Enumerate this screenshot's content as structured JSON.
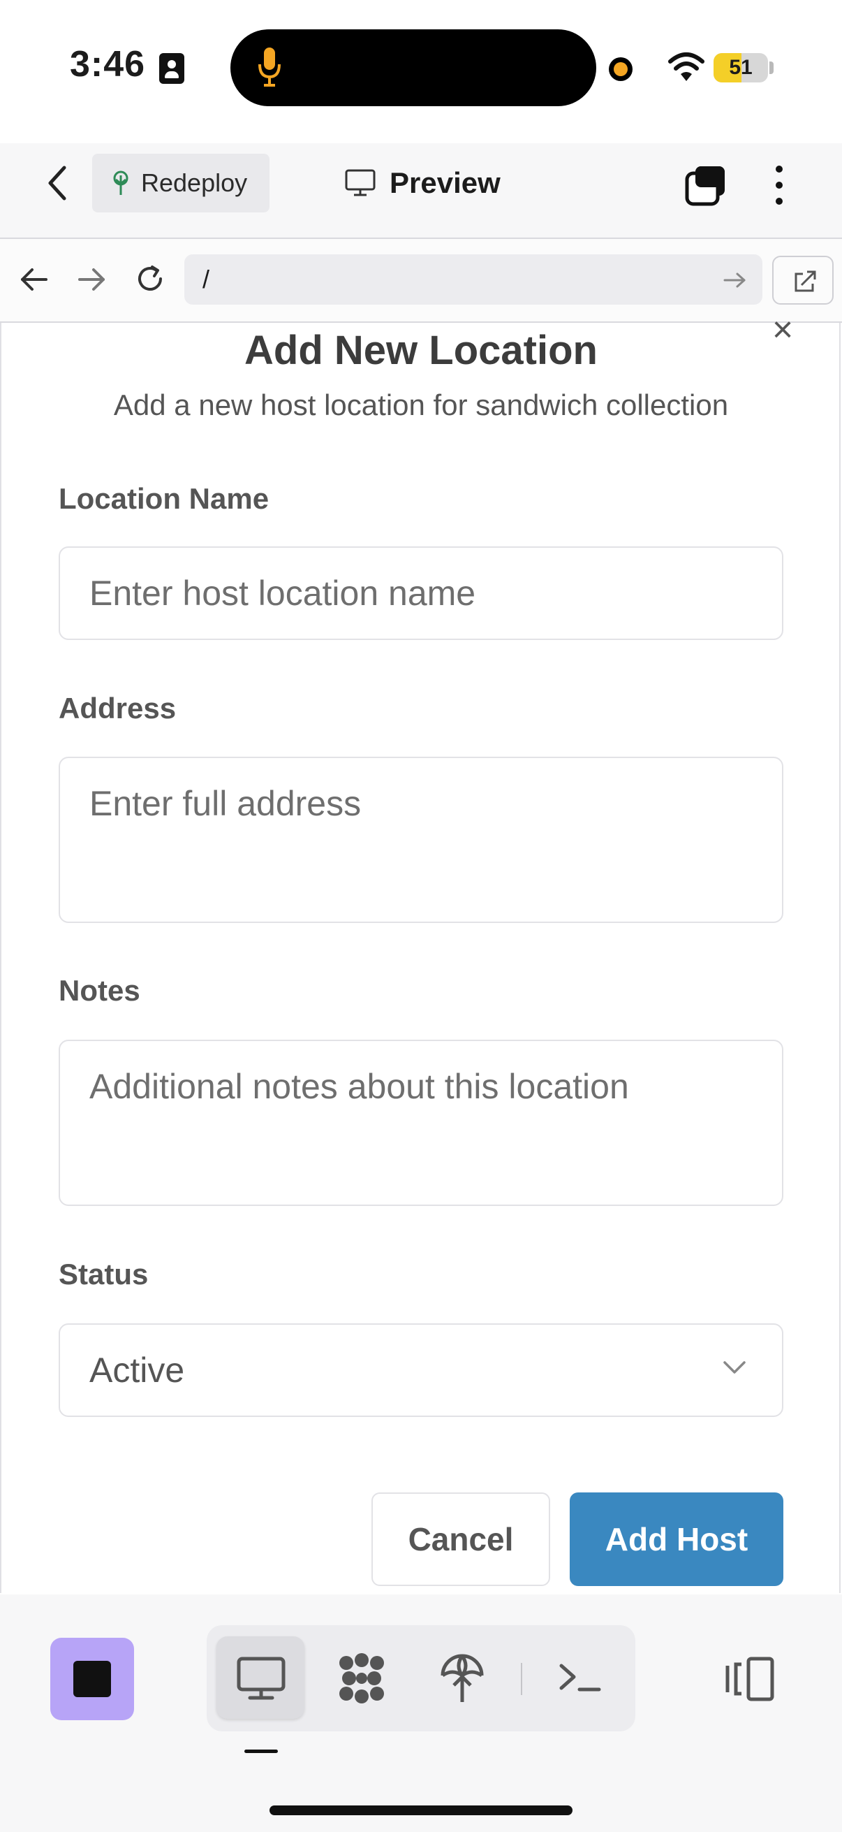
{
  "status_bar": {
    "time": "3:46",
    "battery_level": "51"
  },
  "app_bar": {
    "redeploy_label": "Redeploy",
    "preview_label": "Preview"
  },
  "url_bar": {
    "path": "/"
  },
  "dialog": {
    "title": "Add New Location",
    "subtitle": "Add a new host location for sandwich collection",
    "close_glyph": "×",
    "fields": {
      "name": {
        "label": "Location Name",
        "placeholder": "Enter host location name"
      },
      "address": {
        "label": "Address",
        "placeholder": "Enter full address"
      },
      "notes": {
        "label": "Notes",
        "placeholder": "Additional notes about this location"
      },
      "status": {
        "label": "Status",
        "value": "Active"
      }
    },
    "cancel_label": "Cancel",
    "submit_label": "Add Host",
    "colors": {
      "primary": "#3a88c0"
    }
  },
  "bottom_toolbar": {
    "stop_color": "#b7a4f7",
    "icons": [
      "desktop-icon",
      "components-icon",
      "deploy-icon",
      "terminal-icon",
      "panel-toggle-icon"
    ]
  }
}
